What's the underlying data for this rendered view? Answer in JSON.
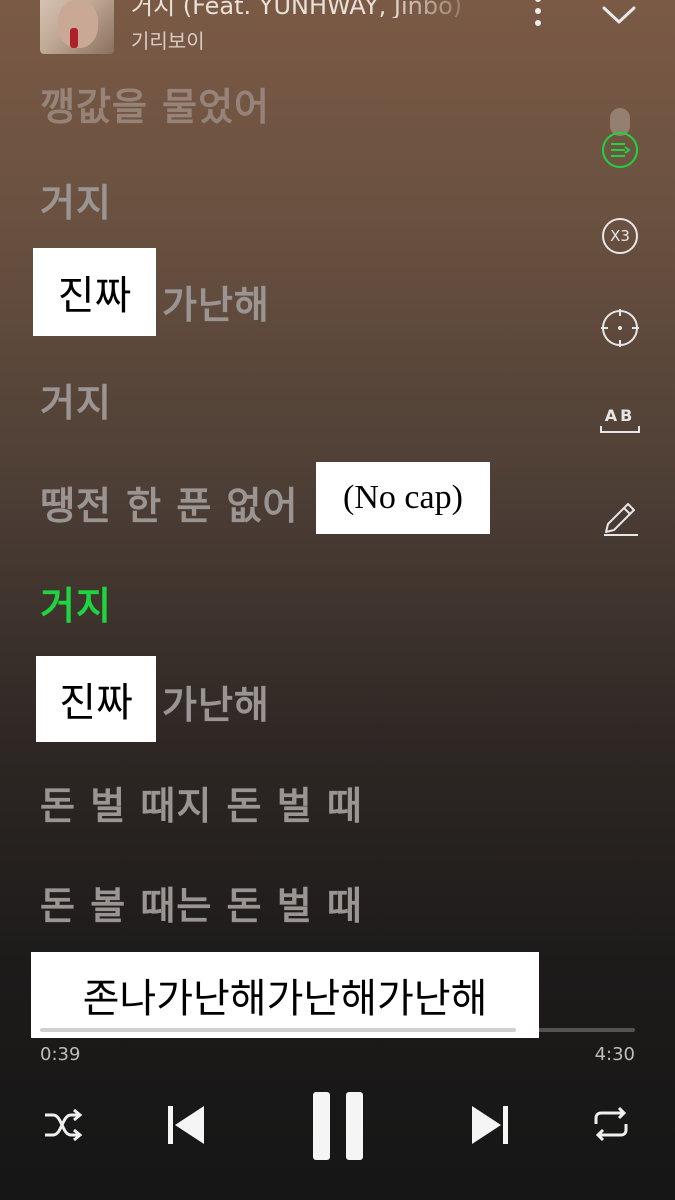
{
  "header": {
    "song_title": "거지 (Feat. YUNHWAY, Jinbo)",
    "artist": "기리보이"
  },
  "lyrics": [
    {
      "text": "깽값을 물었어",
      "state": "faded"
    },
    {
      "text": "거지",
      "state": "normal"
    },
    {
      "text": "가난해",
      "state": "normal"
    },
    {
      "text": "거지",
      "state": "normal"
    },
    {
      "text": "땡전 한 푼 없어",
      "state": "normal"
    },
    {
      "text": "거지",
      "state": "current"
    },
    {
      "text": "가난해",
      "state": "normal"
    },
    {
      "text": "돈 벌 때지 돈 벌 때",
      "state": "normal"
    },
    {
      "text": "돈 볼 때는 돈 벌 때",
      "state": "normal"
    }
  ],
  "captions": {
    "c1": "진짜",
    "c2": "(No cap)",
    "c3": "진짜",
    "c4": "존나가난해가난해가난해"
  },
  "side_tools": [
    {
      "icon": "playlist-icon",
      "active": true
    },
    {
      "label": "X3",
      "icon": "speed-icon"
    },
    {
      "icon": "crosshair-icon"
    },
    {
      "label": "AB",
      "icon": "ab-repeat-icon"
    },
    {
      "icon": "pen-icon"
    }
  ],
  "player": {
    "elapsed": "0:39",
    "duration": "4:30",
    "progress_fraction": 0.8
  },
  "colors": {
    "accent_green": "#1ed43f"
  }
}
